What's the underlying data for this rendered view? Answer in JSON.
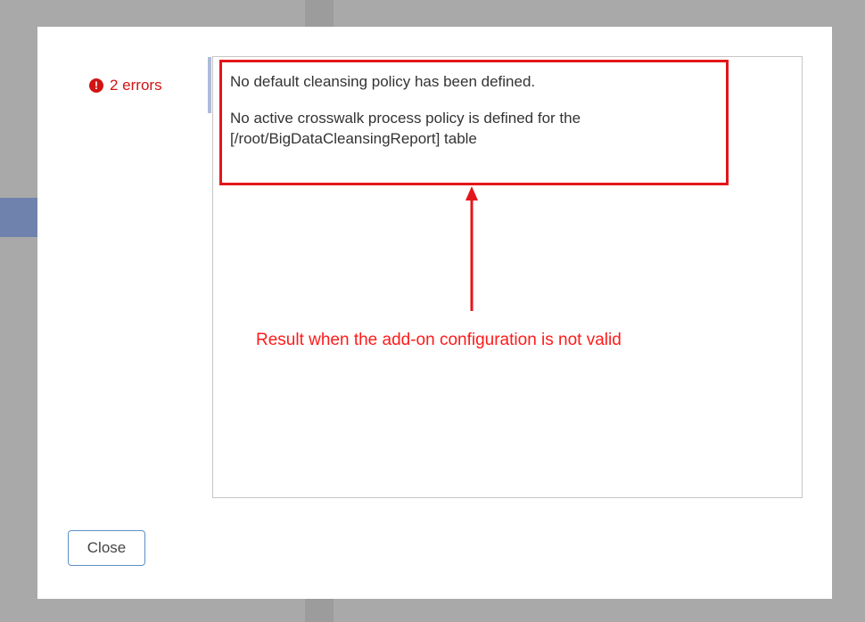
{
  "dialog": {
    "error_summary": {
      "icon": "exclamation-circle-icon",
      "label": "2 errors",
      "color": "#d11414"
    },
    "messages": [
      "No default cleansing policy has been defined.",
      "No active crosswalk process policy is defined for the [/root/BigDataCleansingReport] table"
    ],
    "close_label": "Close"
  },
  "annotation": {
    "text": "Result when the add-on configuration is not valid",
    "color": "#ff1a1a"
  }
}
